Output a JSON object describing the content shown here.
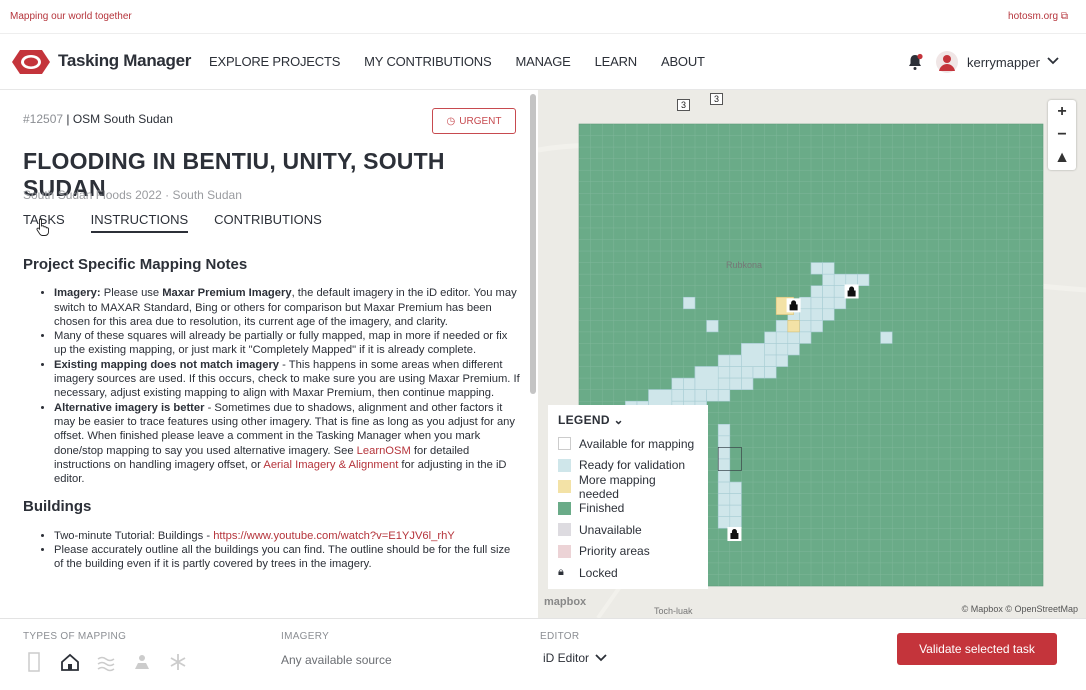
{
  "topbar": {
    "tagline": "Mapping our world together",
    "site_link": "hotosm.org"
  },
  "nav": {
    "brand": "Tasking Manager",
    "links": [
      "EXPLORE PROJECTS",
      "MY CONTRIBUTIONS",
      "MANAGE",
      "LEARN",
      "ABOUT"
    ],
    "username": "kerrymapper"
  },
  "project": {
    "id": "#12507",
    "org": "| OSM South Sudan",
    "urgent_label": "URGENT",
    "title": "FLOODING IN BENTIU, UNITY, SOUTH SUDAN",
    "campaign": "South Sudan Floods 2022",
    "sep": "·",
    "country": "South Sudan",
    "tabs": [
      "TASKS",
      "INSTRUCTIONS",
      "CONTRIBUTIONS"
    ]
  },
  "instructions": {
    "heading1": "Project Specific Mapping Notes",
    "b1_bold1": "Imagery:",
    "b1_t1": " Please use ",
    "b1_bold2": "Maxar Premium Imagery",
    "b1_t2": ", the default imagery in the iD editor. You may switch to MAXAR Standard, Bing or others for comparison but Maxar Premium has been chosen for this area due to resolution, its current age of the imagery, and clarity.",
    "b2": "Many of these squares will already be partially or fully mapped, map in more if needed or fix up the existing mapping, or just mark it \"Completely Mapped\" if it is already complete.",
    "b3_bold": "Existing mapping does not match imagery",
    "b3_t": " - This happens in some areas when different imagery sources are used. If this occurs, check to make sure you are using Maxar Premium. If necessary, adjust existing mapping to align with Maxar Premium, then continue mapping.",
    "b4_bold": "Alternative imagery is better",
    "b4_t1": " - Sometimes due to shadows, alignment and other factors it may be easier to trace features using other imagery. That is fine as long as you adjust for any offset. When finished please leave a comment in the Tasking Manager when you mark done/stop mapping to say you used alternative imagery. See ",
    "b4_link1": "LearnOSM",
    "b4_t2": " for detailed instructions on handling imagery offset, or ",
    "b4_link2": "Aerial Imagery & Alignment",
    "b4_t3": " for adjusting in the iD editor.",
    "heading2": "Buildings",
    "c1_t": "Two-minute Tutorial: Buildings - ",
    "c1_link": "https://www.youtube.com/watch?v=E1YJV6l_rhY",
    "c2": "Please accurately outline all the buildings you can find. The outline should be for the full size of the building even if it is partly covered by trees in the imagery."
  },
  "map": {
    "legend_title": "LEGEND",
    "legend": [
      {
        "label": "Available for mapping",
        "color": "#ffffff"
      },
      {
        "label": "Ready for validation",
        "color": "#cfe6ea"
      },
      {
        "label": "More mapping needed",
        "color": "#f3e2a6"
      },
      {
        "label": "Finished",
        "color": "#6aab88"
      },
      {
        "label": "Unavailable",
        "color": "#dddbe0"
      },
      {
        "label": "Priority areas",
        "color": "#ecd3d6"
      },
      {
        "label": "Locked",
        "color": ""
      }
    ],
    "attribution": "© Mapbox © OpenStreetMap",
    "mapbox": "mapbox",
    "town1": "Toch-luak",
    "town2": "Rubkona",
    "road_labels": [
      "3",
      "3"
    ],
    "colors": {
      "finished": "#6aab88",
      "ready": "#cfe6ea",
      "more": "#f3e2a6"
    }
  },
  "footer": {
    "types_label": "TYPES OF MAPPING",
    "imagery_label": "IMAGERY",
    "imagery_value": "Any available source",
    "editor_label": "EDITOR",
    "editor_value": "iD Editor",
    "validate_button": "Validate selected task",
    "mapping_icons": [
      "roads-icon",
      "buildings-icon",
      "waterways-icon",
      "landuse-icon",
      "other-icon"
    ]
  }
}
